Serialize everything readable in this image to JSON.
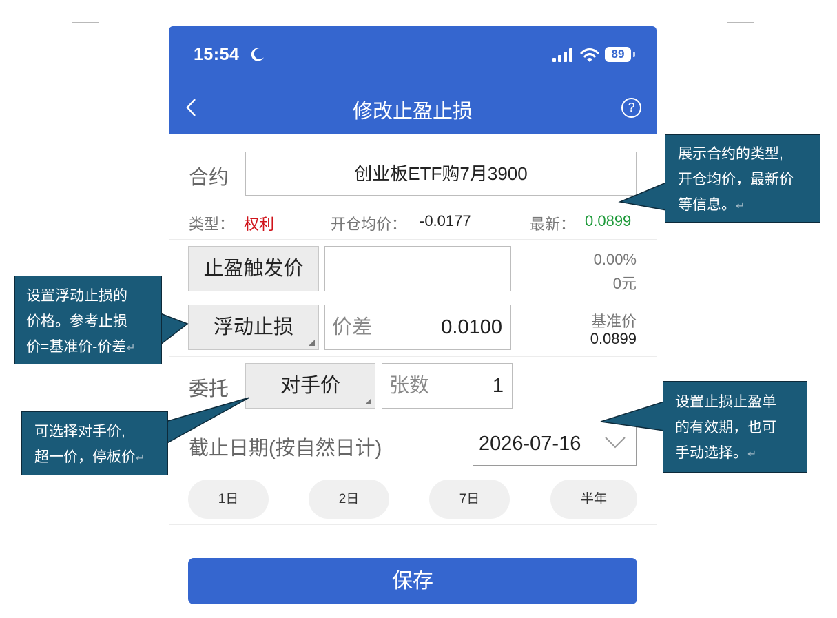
{
  "status": {
    "time": "15:54",
    "battery": "89"
  },
  "nav": {
    "title": "修改止盈止损",
    "help_icon": "?"
  },
  "contract": {
    "label": "合约",
    "value": "创业板ETF购7月3900"
  },
  "info": {
    "type_label": "类型：",
    "type_value": "权利",
    "open_label": "开仓均价：",
    "open_value": "-0.0177",
    "latest_label": "最新：",
    "latest_value": "0.0899"
  },
  "take_profit": {
    "button_label": "止盈触发价",
    "percent": "0.00%",
    "amount": "0元"
  },
  "trailing": {
    "button_label": "浮动止损",
    "spread_label": "价差",
    "spread_value": "0.0100",
    "base_label": "基准价",
    "base_value": "0.0899"
  },
  "order": {
    "label": "委托",
    "price_type": "对手价",
    "qty_label": "张数",
    "qty_value": "1"
  },
  "expiry": {
    "label": "截止日期(按自然日计)",
    "date": "2026-07-16"
  },
  "quick": [
    "1日",
    "2日",
    "7日",
    "半年"
  ],
  "save_label": "保存",
  "callouts": {
    "c1": [
      "展示合约的类型,",
      "开仓均价，最新价",
      "等信息。"
    ],
    "c2": [
      "设置浮动止损的",
      "价格。参考止损",
      "价=基准价-价差"
    ],
    "c3": [
      "可选择对手价,",
      "超一价，停板价"
    ],
    "c4": [
      "设置止损止盈单",
      "的有效期，也可",
      "手动选择。"
    ]
  },
  "colors": {
    "brand": "#3566cf",
    "callout": "#1a5a78",
    "red": "#d0141b",
    "green": "#1e9a3a"
  }
}
